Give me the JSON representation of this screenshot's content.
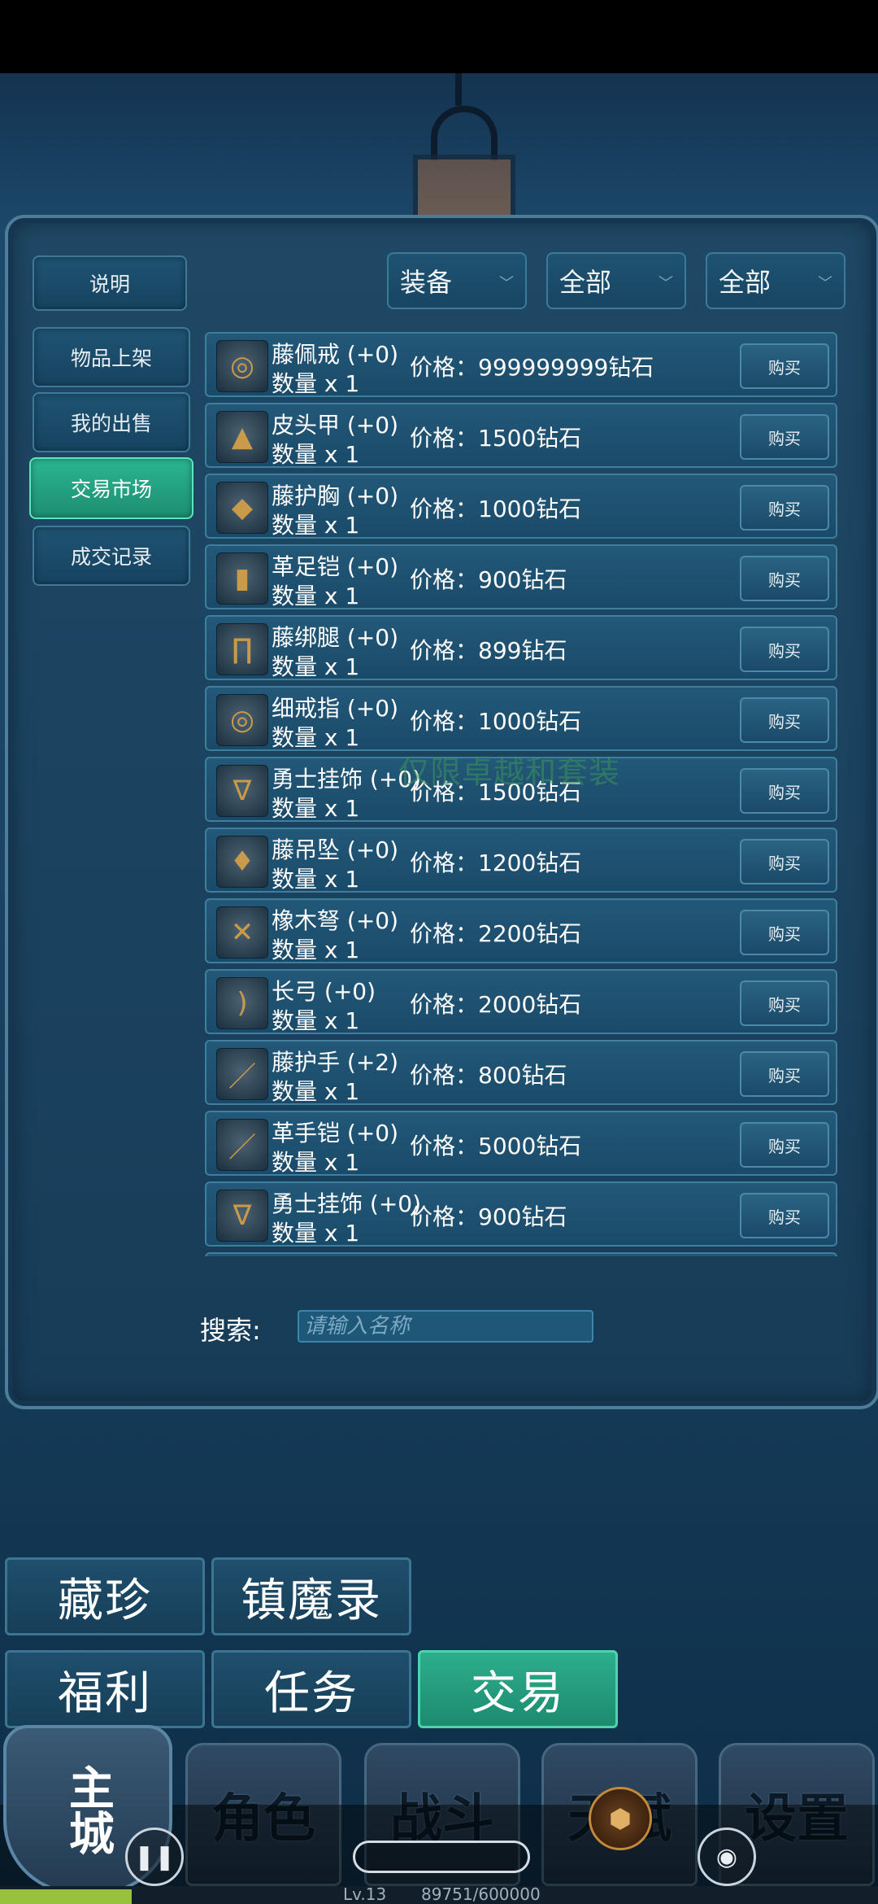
{
  "side_menu": {
    "help": "说明",
    "list_item": "物品上架",
    "my_sales": "我的出售",
    "market": "交易市场",
    "records": "成交记录"
  },
  "filters": [
    "装备",
    "全部",
    "全部"
  ],
  "items": [
    {
      "name": "藤佩戒 (+0)",
      "qty": "数量 x 1",
      "price": "价格：999999999钻石",
      "icon": "ring-icon"
    },
    {
      "name": "皮头甲 (+0)",
      "qty": "数量 x 1",
      "price": "价格：1500钻石",
      "icon": "helmet-icon"
    },
    {
      "name": "藤护胸 (+0)",
      "qty": "数量 x 1",
      "price": "价格：1000钻石",
      "icon": "chest-armor-icon"
    },
    {
      "name": "革足铠 (+0)",
      "qty": "数量 x 1",
      "price": "价格：900钻石",
      "icon": "boots-icon"
    },
    {
      "name": "藤绑腿 (+0)",
      "qty": "数量 x 1",
      "price": "价格：899钻石",
      "icon": "leggings-icon"
    },
    {
      "name": "细戒指 (+0)",
      "qty": "数量 x 1",
      "price": "价格：1000钻石",
      "icon": "ring-icon"
    },
    {
      "name": "勇士挂饰 (+0)",
      "qty": "数量 x 1",
      "price": "价格：1500钻石",
      "icon": "necklace-icon"
    },
    {
      "name": "藤吊坠 (+0)",
      "qty": "数量 x 1",
      "price": "价格：1200钻石",
      "icon": "pendant-icon"
    },
    {
      "name": "橡木弩 (+0)",
      "qty": "数量 x 1",
      "price": "价格：2200钻石",
      "icon": "crossbow-icon"
    },
    {
      "name": "长弓 (+0)",
      "qty": "数量 x 1",
      "price": "价格：2000钻石",
      "icon": "bow-icon"
    },
    {
      "name": "藤护手 (+2)",
      "qty": "数量 x 1",
      "price": "价格：800钻石",
      "icon": "bracer-icon"
    },
    {
      "name": "革手铠 (+0)",
      "qty": "数量 x 1",
      "price": "价格：5000钻石",
      "icon": "gauntlet-icon"
    },
    {
      "name": "勇士挂饰 (+0)",
      "qty": "数量 x 1",
      "price": "价格：900钻石",
      "icon": "necklace-icon"
    }
  ],
  "buy_label": "购买",
  "watermark": "仅限卓越和套装",
  "search": {
    "label": "搜索:",
    "placeholder": "请输入名称"
  },
  "menu": {
    "treasure": "藏珍",
    "demon_record": "镇魔录",
    "welfare": "福利",
    "quest": "任务",
    "trade": "交易"
  },
  "nav": {
    "main_city": "主城",
    "character": "角色",
    "battle": "战斗",
    "talent": "天赋",
    "settings": "设置"
  },
  "player": {
    "level": "Lv.13",
    "exp": "89751/600000",
    "exp_fraction": 0.15
  },
  "colors": {
    "active": "#2bb591",
    "panel": "#1b4360"
  }
}
